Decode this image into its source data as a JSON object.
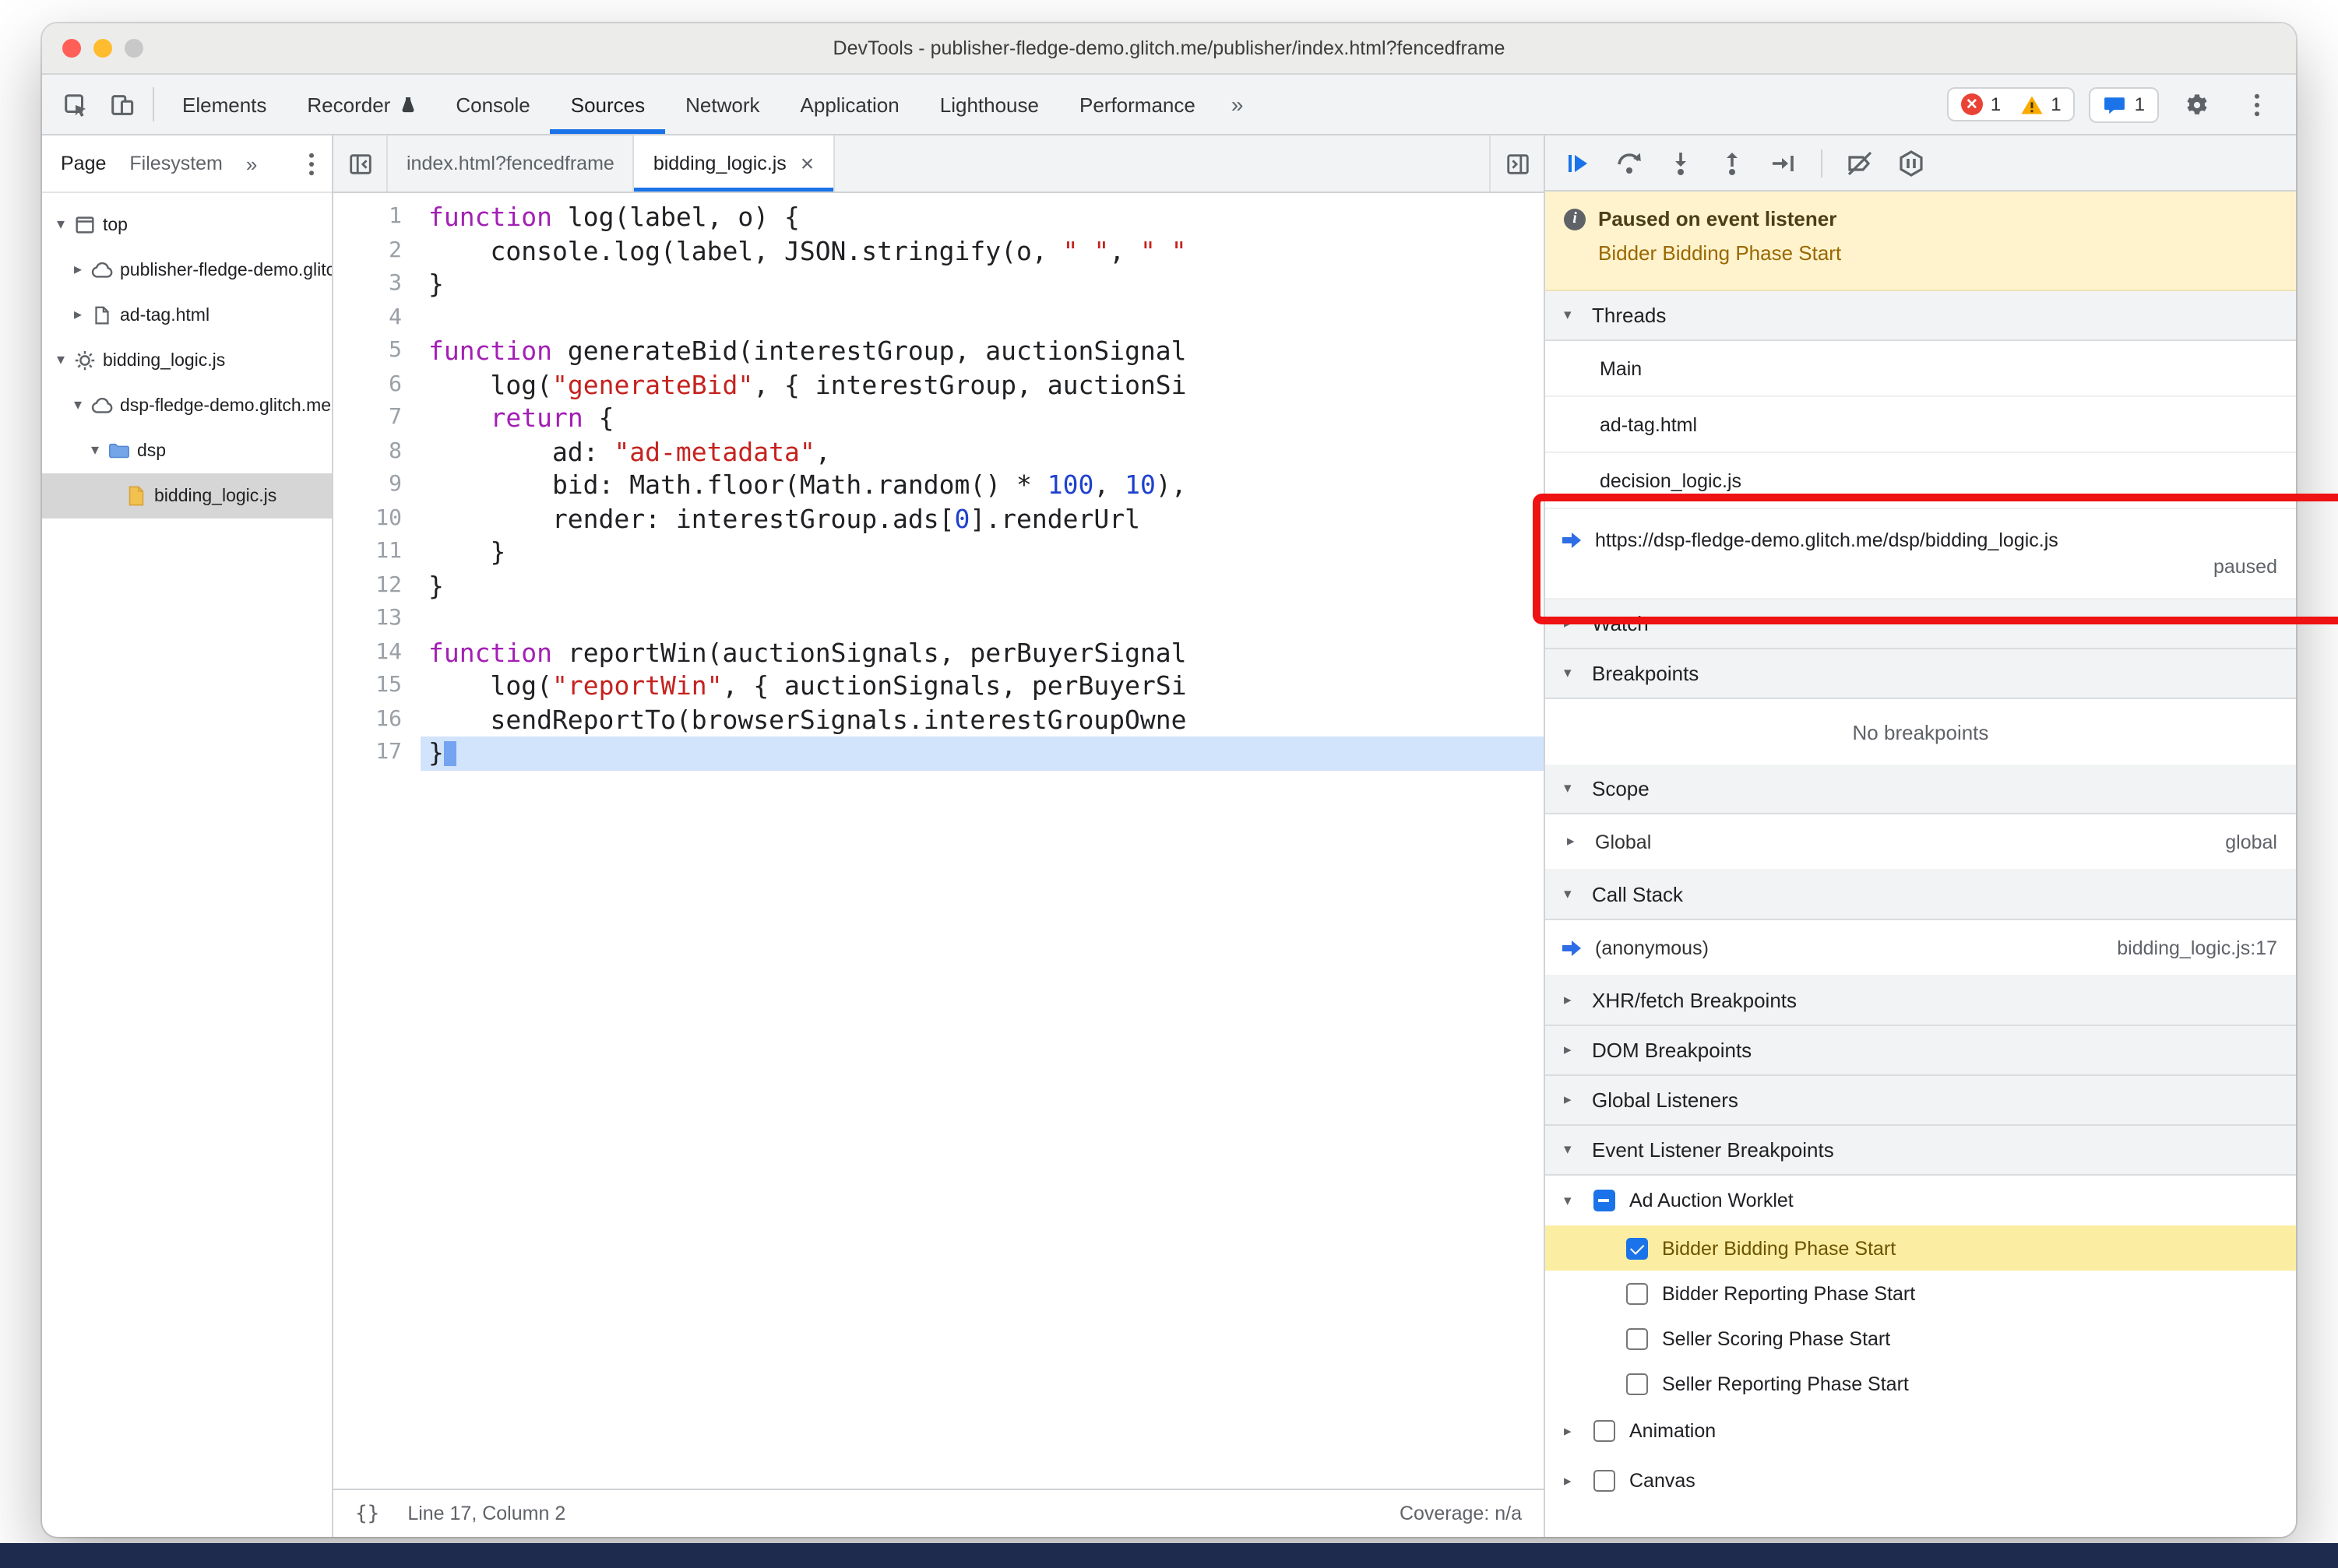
{
  "colors": {
    "accent": "#1a73e8",
    "error": "#ea4335",
    "warning": "#f9ab00",
    "paused_banner_bg": "#fff3cd",
    "breakpoint_highlight": "#fbeea2",
    "annotation": "#ee1212",
    "footer_strip": "#1e2b4e"
  },
  "window": {
    "title": "DevTools - publisher-fledge-demo.glitch.me/publisher/index.html?fencedframe"
  },
  "toolbar": {
    "tabs": [
      {
        "label": "Elements"
      },
      {
        "label": "Recorder",
        "badge": "experiment"
      },
      {
        "label": "Console"
      },
      {
        "label": "Sources",
        "active": true
      },
      {
        "label": "Network"
      },
      {
        "label": "Application"
      },
      {
        "label": "Lighthouse"
      },
      {
        "label": "Performance"
      }
    ],
    "more_label": "»",
    "error_count": "1",
    "warning_count": "1",
    "issues_count": "1"
  },
  "sidebar": {
    "tabs": [
      {
        "label": "Page",
        "active": true
      },
      {
        "label": "Filesystem"
      }
    ],
    "more_label": "»",
    "tree": [
      {
        "label": "top",
        "icon": "frame",
        "arrow": "open",
        "depth": 0
      },
      {
        "label": "publisher-fledge-demo.glitch.me",
        "icon": "cloud",
        "arrow": "closed",
        "depth": 1
      },
      {
        "label": "ad-tag.html",
        "icon": "document",
        "arrow": "closed",
        "depth": 1
      },
      {
        "label": "bidding_logic.js",
        "icon": "worklet",
        "arrow": "open",
        "depth": 0
      },
      {
        "label": "dsp-fledge-demo.glitch.me",
        "icon": "cloud",
        "arrow": "open",
        "depth": 1
      },
      {
        "label": "dsp",
        "icon": "folder",
        "arrow": "open",
        "depth": 2
      },
      {
        "label": "bidding_logic.js",
        "icon": "file",
        "arrow": "none",
        "depth": 3,
        "selected": true
      }
    ]
  },
  "editor": {
    "tabs": [
      {
        "label": "index.html?fencedframe"
      },
      {
        "label": "bidding_logic.js",
        "active": true,
        "closable": true
      }
    ],
    "close_glyph": "×",
    "format_glyph": "{}",
    "status_left": "Line 17, Column 2",
    "status_right": "Coverage: n/a",
    "lines": [
      {
        "n": "1",
        "seg": [
          [
            "kw",
            "function"
          ],
          [
            "pl",
            " log(label, o) {"
          ]
        ]
      },
      {
        "n": "2",
        "seg": [
          [
            "pl",
            "    console.log(label, JSON.stringify(o, "
          ],
          [
            "str",
            "\" \""
          ],
          [
            "pl",
            ", "
          ],
          [
            "str",
            "\" \""
          ]
        ]
      },
      {
        "n": "3",
        "seg": [
          [
            "pl",
            "}"
          ]
        ]
      },
      {
        "n": "4",
        "seg": []
      },
      {
        "n": "5",
        "seg": [
          [
            "kw",
            "function"
          ],
          [
            "pl",
            " generateBid(interestGroup, auctionSignal"
          ]
        ]
      },
      {
        "n": "6",
        "seg": [
          [
            "pl",
            "    log("
          ],
          [
            "str",
            "\"generateBid\""
          ],
          [
            "pl",
            ", { interestGroup, auctionSi"
          ]
        ]
      },
      {
        "n": "7",
        "seg": [
          [
            "pl",
            "    "
          ],
          [
            "kw",
            "return"
          ],
          [
            "pl",
            " {"
          ]
        ]
      },
      {
        "n": "8",
        "seg": [
          [
            "pl",
            "        ad: "
          ],
          [
            "str",
            "\"ad-metadata\""
          ],
          [
            "pl",
            ","
          ]
        ]
      },
      {
        "n": "9",
        "seg": [
          [
            "pl",
            "        bid: Math.floor(Math.random() * "
          ],
          [
            "num",
            "100"
          ],
          [
            "pl",
            ", "
          ],
          [
            "num",
            "10"
          ],
          [
            "pl",
            "),"
          ]
        ]
      },
      {
        "n": "10",
        "seg": [
          [
            "pl",
            "        render: interestGroup.ads["
          ],
          [
            "num",
            "0"
          ],
          [
            "pl",
            "].renderUrl"
          ]
        ]
      },
      {
        "n": "11",
        "seg": [
          [
            "pl",
            "    }"
          ]
        ]
      },
      {
        "n": "12",
        "seg": [
          [
            "pl",
            "}"
          ]
        ]
      },
      {
        "n": "13",
        "seg": []
      },
      {
        "n": "14",
        "seg": [
          [
            "kw",
            "function"
          ],
          [
            "pl",
            " reportWin(auctionSignals, perBuyerSignal"
          ]
        ]
      },
      {
        "n": "15",
        "seg": [
          [
            "pl",
            "    log("
          ],
          [
            "str",
            "\"reportWin\""
          ],
          [
            "pl",
            ", { auctionSignals, perBuyerSi"
          ]
        ]
      },
      {
        "n": "16",
        "seg": [
          [
            "pl",
            "    sendReportTo(browserSignals.interestGroupOwne"
          ]
        ]
      },
      {
        "n": "17",
        "seg": [
          [
            "pl",
            "}"
          ]
        ],
        "exec": true
      }
    ]
  },
  "debugger": {
    "paused": {
      "title": "Paused on event listener",
      "subtitle": "Bidder Bidding Phase Start"
    },
    "threads": {
      "title": "Threads",
      "items": [
        {
          "label": "Main"
        },
        {
          "label": "ad-tag.html"
        },
        {
          "label": "decision_logic.js"
        },
        {
          "label": "https://dsp-fledge-demo.glitch.me/dsp/bidding_logic.js",
          "active": true,
          "status": "paused"
        }
      ]
    },
    "watch": {
      "title": "Watch"
    },
    "breakpoints": {
      "title": "Breakpoints",
      "empty": "No breakpoints"
    },
    "scope": {
      "title": "Scope",
      "rows": [
        {
          "label": "Global",
          "value": "global"
        }
      ]
    },
    "call_stack": {
      "title": "Call Stack",
      "frames": [
        {
          "label": "(anonymous)",
          "location": "bidding_logic.js:17"
        }
      ]
    },
    "collapsed_sections": [
      "XHR/fetch Breakpoints",
      "DOM Breakpoints",
      "Global Listeners"
    ],
    "event_listener_breakpoints": {
      "title": "Event Listener Breakpoints",
      "groups": [
        {
          "label": "Ad Auction Worklet",
          "checkbox": "indeterminate",
          "expanded": true,
          "items": [
            {
              "label": "Bidder Bidding Phase Start",
              "checked": true,
              "highlighted": true
            },
            {
              "label": "Bidder Reporting Phase Start",
              "checked": false
            },
            {
              "label": "Seller Scoring Phase Start",
              "checked": false
            },
            {
              "label": "Seller Reporting Phase Start",
              "checked": false
            }
          ]
        },
        {
          "label": "Animation",
          "checkbox": "unchecked",
          "expanded": false
        },
        {
          "label": "Canvas",
          "checkbox": "unchecked",
          "expanded": false
        }
      ]
    }
  }
}
